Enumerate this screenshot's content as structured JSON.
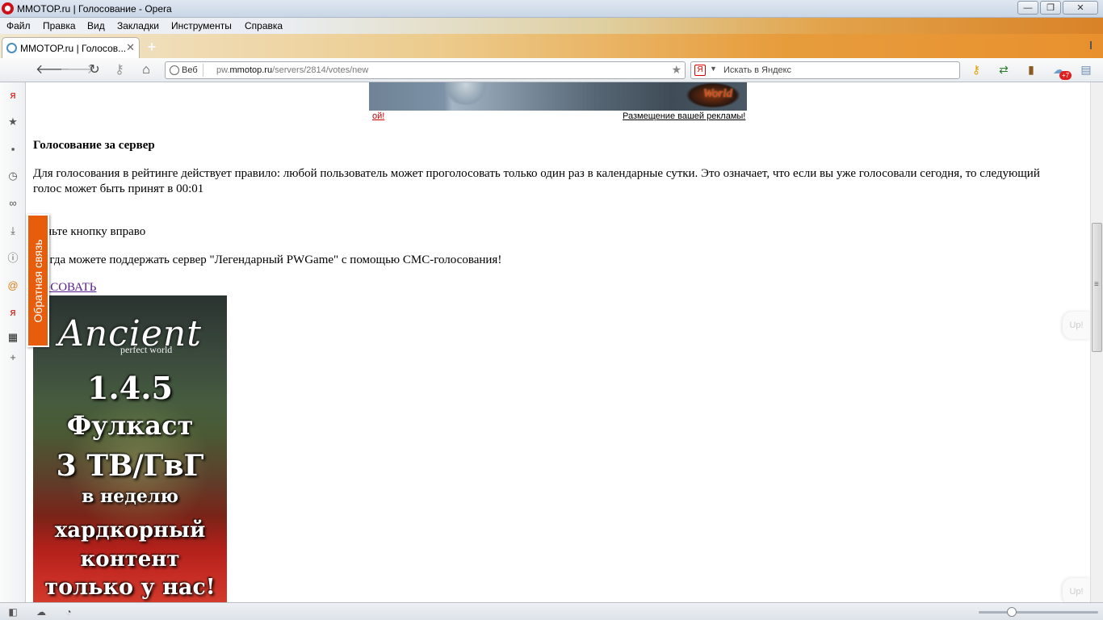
{
  "window": {
    "title": "MMOTOP.ru | Голосование - Opera",
    "controls": {
      "minimize": "—",
      "maximize": "❐",
      "close": "✕"
    }
  },
  "menu": {
    "items": [
      "Файл",
      "Правка",
      "Вид",
      "Закладки",
      "Инструменты",
      "Справка"
    ]
  },
  "tabs": [
    {
      "label": "MMOTOP.ru | Голосов...",
      "close": "✕"
    }
  ],
  "new_tab_label": "+",
  "toolbar": {
    "address_badge": "Веб",
    "url_prefix": "pw.",
    "url_domain": "mmotop.ru",
    "url_path": "/servers/2814/votes/new",
    "search_logo": "Я",
    "search_placeholder": "Искать в Яндекс",
    "notification_count": "+7"
  },
  "icons": {
    "back": "back-arrow-icon",
    "forward": "forward-arrow-icon",
    "reload": "reload-icon",
    "wand": "key-icon",
    "home": "home-icon",
    "bookmark_star": "star-icon"
  },
  "side_panel": {
    "icons": [
      "yandex-icon",
      "bookmarks-star-icon",
      "notes-icon",
      "history-icon",
      "links-icon",
      "downloads-icon",
      "info-icon",
      "mail-icon",
      "yandex-bar-icon",
      "film-icon",
      "add-panel-icon"
    ]
  },
  "feedback_tab": "Обратная связь",
  "content": {
    "ad_left": "ой!",
    "ad_right": "Размещение вашей рекламы!",
    "banner_logo": "World",
    "vote_title": "Голосование за сервер",
    "vote_rule": "Для голосования в рейтинге действует правило: любой пользователь может проголосовать только один раз в календарные сутки. Это означает, что если вы уже голосовали сегодня, то следующий голос может быть принят в 00:01",
    "slide_instruction": "виньте кнопку вправо",
    "sms_text": "всегда можете поддержать сервер \"Легендарный PWGame\" с помощью СМС-голосования!",
    "vote_link": "ЛОСОВАТЬ",
    "promo": {
      "brand": "Ancient",
      "subtitle": "perfect world",
      "lines": [
        "1.4.5",
        "Фулкаст",
        "3 ТВ/ГвГ",
        "в неделю",
        "хардкорный",
        "контент",
        "только у нас!"
      ]
    },
    "up_button": "Up!"
  },
  "status_bar": {
    "zoom_level": 0.24
  }
}
